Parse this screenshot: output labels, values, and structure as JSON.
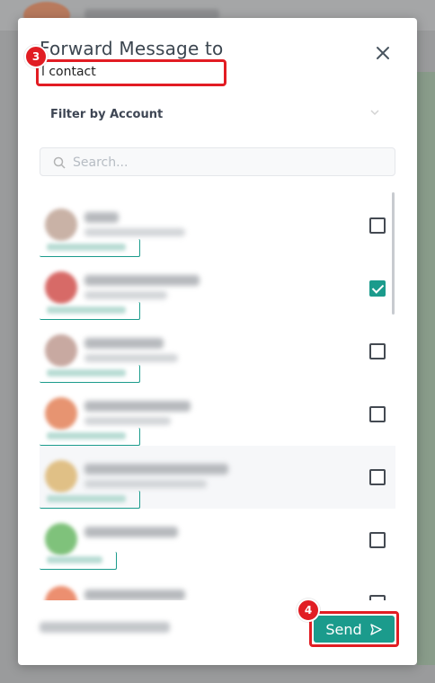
{
  "modal": {
    "title": "Forward Message to",
    "tooltip_text": "l contact",
    "filter_label": "Filter by Account",
    "search_placeholder": "Search...",
    "send_label": "Send",
    "step_badges": {
      "first": "3",
      "second": "4"
    }
  },
  "contacts": [
    {
      "checked": false,
      "avatar_color": "#c9b2a6"
    },
    {
      "checked": true,
      "avatar_color": "#d76a67"
    },
    {
      "checked": false,
      "avatar_color": "#c8a9a1"
    },
    {
      "checked": false,
      "avatar_color": "#e79471"
    },
    {
      "checked": false,
      "avatar_color": "#e0c086"
    },
    {
      "checked": false,
      "avatar_color": "#7fc27b"
    },
    {
      "checked": false,
      "avatar_color": "#ec8f70"
    }
  ],
  "colors": {
    "accent": "#1b9b8c",
    "highlight": "#e11d23"
  }
}
